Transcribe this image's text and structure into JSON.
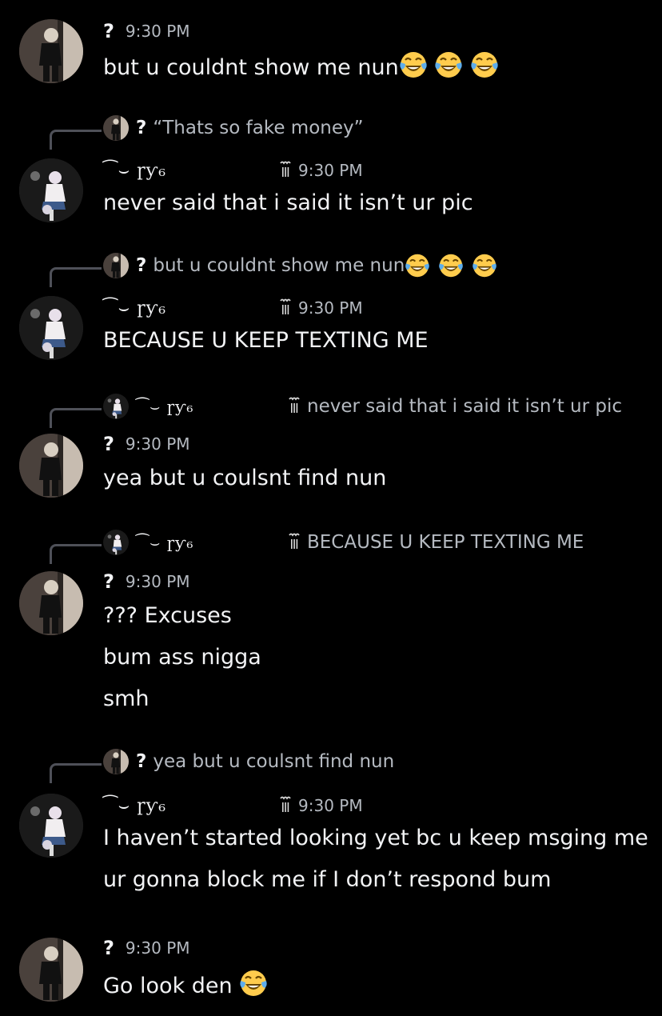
{
  "messages": [
    {
      "author": "?",
      "time": "9:30 PM",
      "lines": [
        "but u couldnt show me nun"
      ]
    },
    {
      "reply": {
        "author": "?",
        "text": "“Thats so fake money”"
      },
      "author": "⁀⌣  ɼƴ₆",
      "time": "9:30 PM",
      "lines": [
        "never said that i said it isn’t ur pic"
      ]
    },
    {
      "reply": {
        "author": "?",
        "text": "but u couldnt show me nun"
      },
      "author": "⁀⌣  ɼƴ₆",
      "time": "9:30 PM",
      "lines": [
        "BECAUSE U KEEP TEXTING ME"
      ]
    },
    {
      "reply": {
        "author": "⁀⌣  ɼƴ₆",
        "text": "never said that i said it isn’t ur pic"
      },
      "author": "?",
      "time": "9:30 PM",
      "lines": [
        "yea but u coulsnt find nun"
      ]
    },
    {
      "reply": {
        "author": "⁀⌣  ɼƴ₆",
        "text": "BECAUSE U KEEP TEXTING ME"
      },
      "author": "?",
      "time": "9:30 PM",
      "lines": [
        "??? Excuses",
        "bum ass nigga",
        "smh"
      ]
    },
    {
      "reply": {
        "author": "?",
        "text": "yea but u coulsnt find nun"
      },
      "author": "⁀⌣  ɼƴ₆",
      "time": "9:30 PM",
      "lines": [
        "I haven’t started looking yet bc u keep msging me",
        "ur gonna block me if I don’t respond bum"
      ]
    },
    {
      "author": "?",
      "time": "9:30 PM",
      "lines": [
        "Go look den"
      ]
    }
  ],
  "emoji": {
    "laugh": "face-with-tears-of-joy-emoji"
  }
}
